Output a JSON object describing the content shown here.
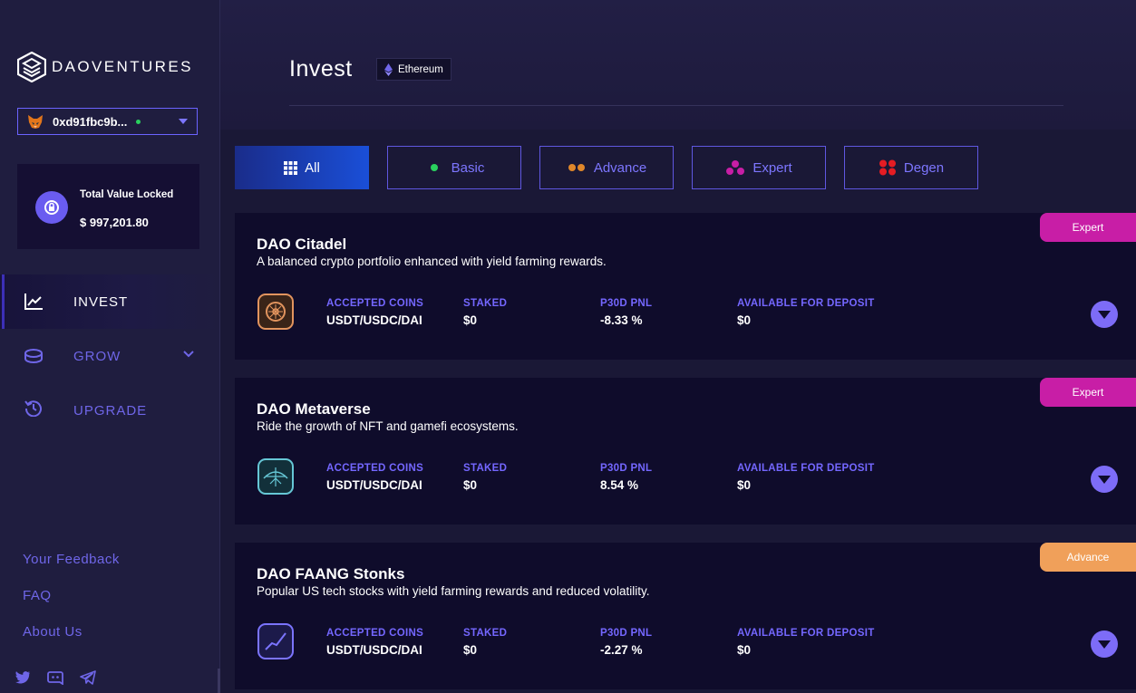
{
  "brand": {
    "name": "DAOVENTURES"
  },
  "wallet": {
    "address": "0xd91fbc9b...",
    "status_color": "#2ad15e"
  },
  "tvl": {
    "label": "Total Value Locked",
    "value": "$ 997,201.80"
  },
  "nav": [
    {
      "label": "INVEST",
      "icon": "chart-line-icon",
      "active": true
    },
    {
      "label": "GROW",
      "icon": "coins-icon",
      "active": false
    },
    {
      "label": "UPGRADE",
      "icon": "history-icon",
      "active": false
    }
  ],
  "footer_links": [
    "Your Feedback",
    "FAQ",
    "About Us"
  ],
  "social": [
    "twitter-icon",
    "discord-icon",
    "telegram-icon"
  ],
  "header": {
    "title": "Invest",
    "network": "Ethereum"
  },
  "filters": [
    {
      "label": "All",
      "icon": "grid-icon",
      "active": true
    },
    {
      "label": "Basic",
      "icon": "one-dot-icon",
      "active": false
    },
    {
      "label": "Advance",
      "icon": "two-dots-icon",
      "active": false
    },
    {
      "label": "Expert",
      "icon": "three-dots-icon",
      "active": false
    },
    {
      "label": "Degen",
      "icon": "four-dots-icon",
      "active": false
    }
  ],
  "columns": {
    "coins": "ACCEPTED COINS",
    "staked": "STAKED",
    "pnl": "P30D PNL",
    "available": "AVAILABLE FOR DEPOSIT"
  },
  "strategies": [
    {
      "name": "DAO Citadel",
      "description": "A balanced crypto portfolio enhanced with yield farming rewards.",
      "badge": "Expert",
      "badge_color": "#c81ea6",
      "coins": "USDT/USDC/DAI",
      "staked": "$0",
      "pnl": "-8.33 %",
      "available": "$0",
      "icon": "citadel-icon"
    },
    {
      "name": "DAO Metaverse",
      "description": "Ride the growth of NFT and gamefi ecosystems.",
      "badge": "Expert",
      "badge_color": "#c81ea6",
      "coins": "USDT/USDC/DAI",
      "staked": "$0",
      "pnl": "8.54 %",
      "available": "$0",
      "icon": "metaverse-icon"
    },
    {
      "name": "DAO FAANG Stonks",
      "description": "Popular US tech stocks with yield farming rewards and reduced volatility.",
      "badge": "Advance",
      "badge_color": "#f0a05a",
      "coins": "USDT/USDC/DAI",
      "staked": "$0",
      "pnl": "-2.27 %",
      "available": "$0",
      "icon": "stonks-icon"
    }
  ],
  "colors": {
    "accent": "#6f66e8",
    "sidebar_bg": "#1f1d3f",
    "card_bg": "#0f0c2b"
  }
}
